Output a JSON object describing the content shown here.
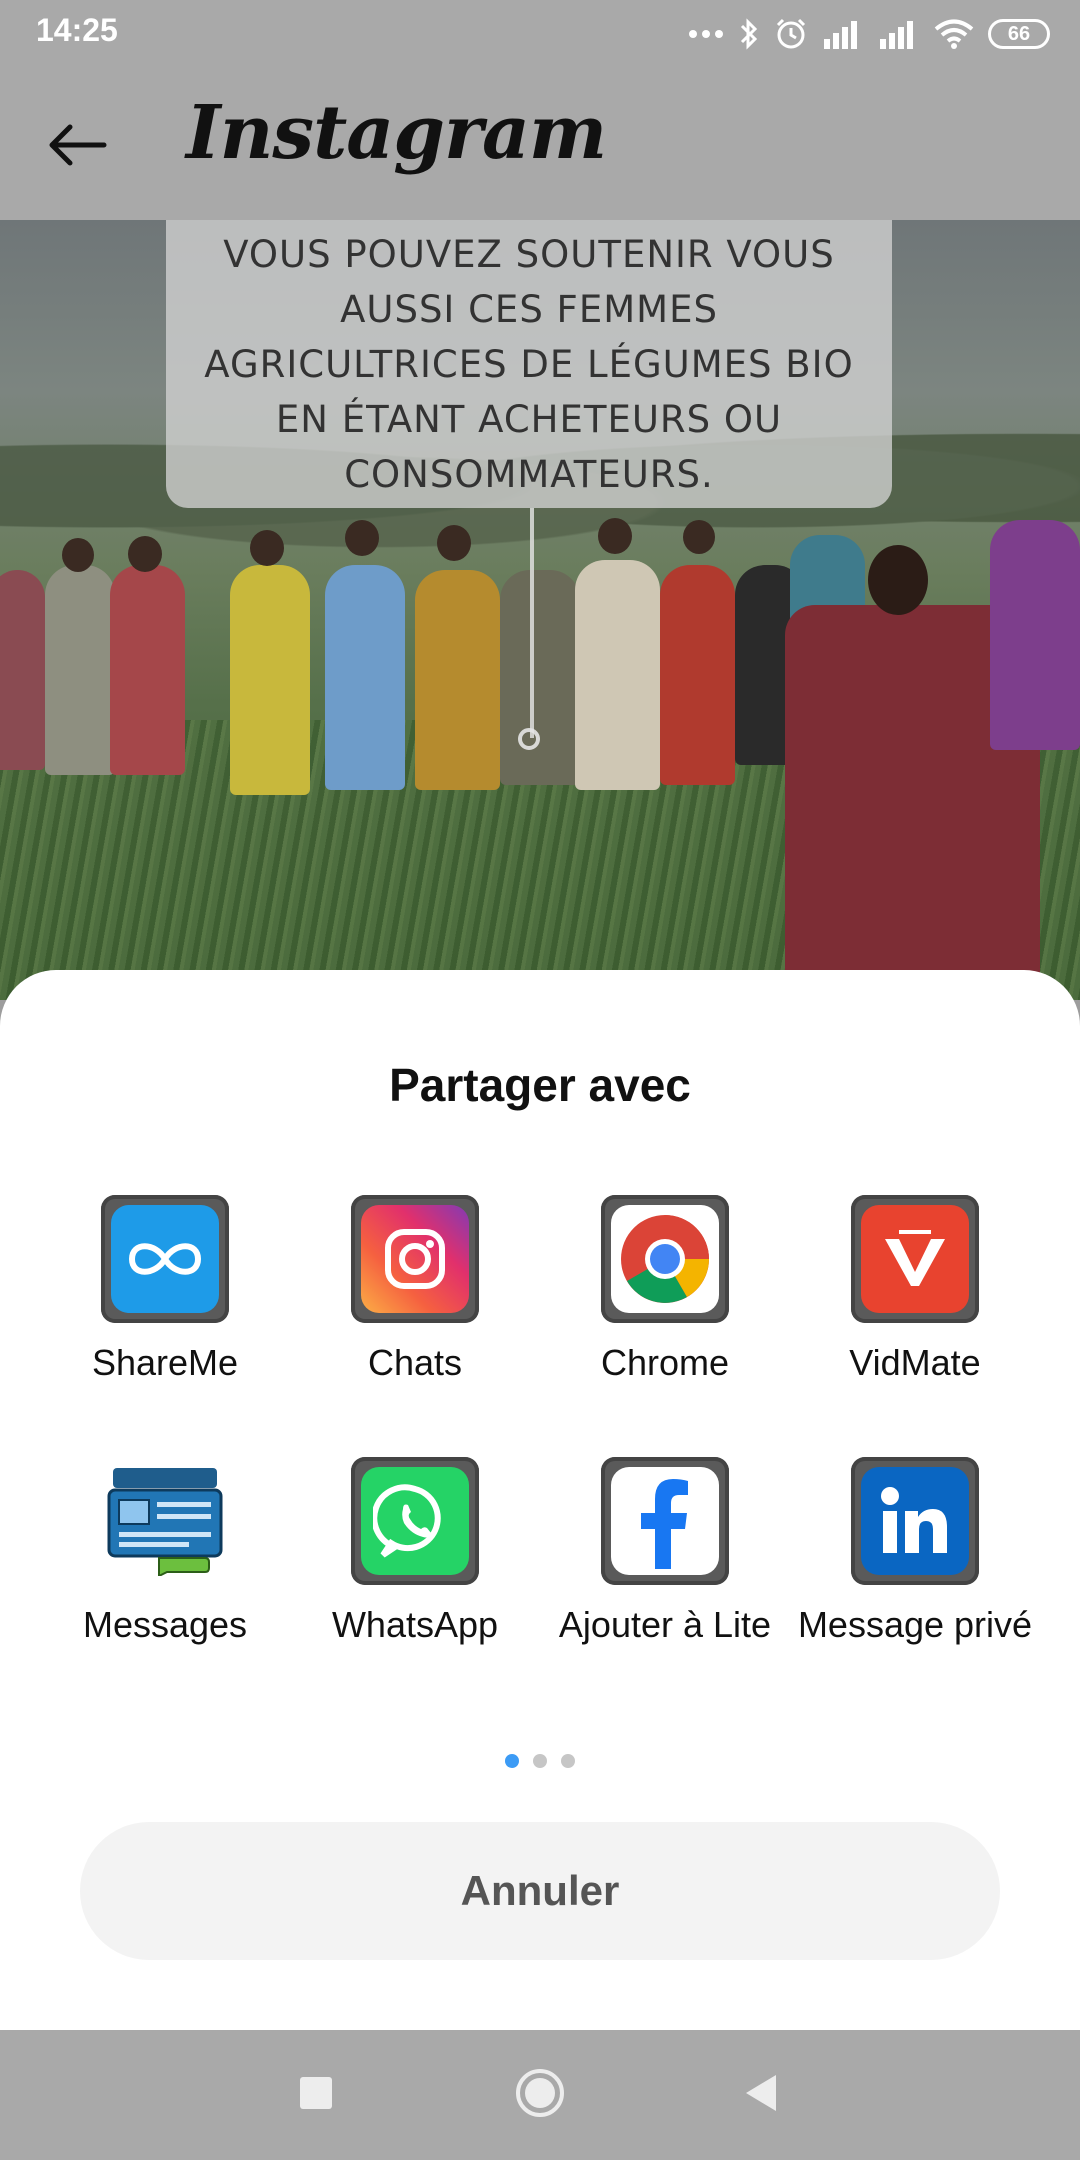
{
  "status_bar": {
    "time": "14:25",
    "battery": "66",
    "icons": [
      "more-dots-icon",
      "bluetooth-icon",
      "alarm-icon",
      "signal-icon",
      "signal-icon",
      "wifi-icon",
      "battery-icon"
    ]
  },
  "app_bar": {
    "title": "Instagram",
    "back_icon": "arrow-left-icon"
  },
  "video": {
    "caption": "VOUS POUVEZ SOUTENIR VOUS AUSSI CES FEMMES AGRICULTRICES DE LÉGUMES BIO EN ÉTANT ACHETEURS OU CONSOMMATEURS."
  },
  "share_sheet": {
    "title": "Partager avec",
    "apps": [
      {
        "label": "ShareMe",
        "icon": "shareme-icon"
      },
      {
        "label": "Chats",
        "icon": "instagram-icon"
      },
      {
        "label": "Chrome",
        "icon": "chrome-icon"
      },
      {
        "label": "VidMate",
        "icon": "vidmate-icon"
      },
      {
        "label": "Messages",
        "icon": "messages-icon"
      },
      {
        "label": "WhatsApp",
        "icon": "whatsapp-icon"
      },
      {
        "label": "Ajouter à Lite",
        "icon": "facebook-icon"
      },
      {
        "label": "Message privé",
        "icon": "linkedin-icon"
      }
    ],
    "page_indicator": {
      "pages": 3,
      "current": 1
    },
    "cancel_label": "Annuler"
  },
  "colors": {
    "accent_dot": "#3c9bf5",
    "shareme": "#1e9be8",
    "vidmate": "#e8432f",
    "whatsapp": "#25d366",
    "facebook": "#1877f2",
    "linkedin": "#0a66c2"
  }
}
